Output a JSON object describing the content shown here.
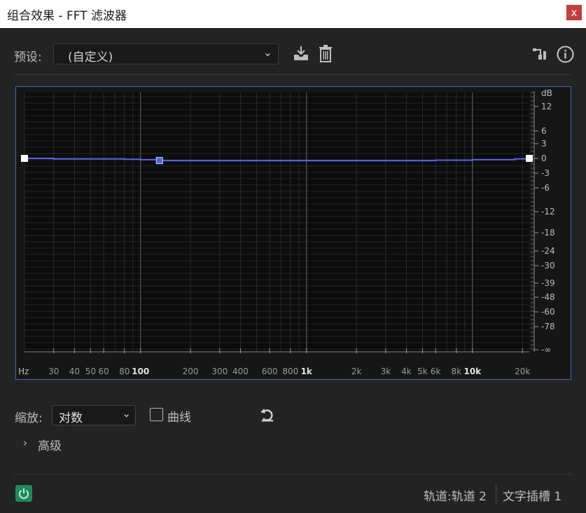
{
  "window": {
    "title": "组合效果 - FFT 滤波器",
    "close_glyph": "x"
  },
  "presets": {
    "label": "预设:",
    "value": "(自定义)"
  },
  "graph": {
    "db_unit": "dB",
    "db_ticks": [
      "12",
      "6",
      "3",
      "0",
      "-3",
      "-6",
      "-12",
      "-18",
      "-24",
      "-30",
      "-39",
      "-48",
      "-60",
      "-78",
      "-∞"
    ],
    "freq_unit": "Hz",
    "freq_ticks": [
      "30",
      "40",
      "50",
      "60",
      "80",
      "100",
      "200",
      "300",
      "400",
      "600",
      "800",
      "1k",
      "2k",
      "3k",
      "4k",
      "5k",
      "6k",
      "8k",
      "10k",
      "20k"
    ],
    "curve_color": "#5a64e6",
    "grid_color": "#3c3c3c"
  },
  "chart_data": {
    "type": "line",
    "title": "",
    "xlabel": "Hz",
    "ylabel": "dB",
    "x_scale": "log",
    "xlim": [
      20,
      22000
    ],
    "series": [
      {
        "x": [
          20,
          30,
          50,
          80,
          100,
          130,
          4000,
          6000,
          10000,
          18000,
          22000
        ],
        "values": [
          0,
          -0.1,
          -0.1,
          -0.2,
          -0.3,
          -0.5,
          -0.5,
          -0.4,
          -0.3,
          -0.1,
          0
        ]
      }
    ],
    "control_points": [
      {
        "x": 20,
        "y": 0
      },
      {
        "x": 130,
        "y": -0.5
      },
      {
        "x": 22000,
        "y": 0
      }
    ]
  },
  "scale": {
    "label": "缩放:",
    "value": "对数"
  },
  "curve_option": {
    "label": "曲线"
  },
  "advanced": {
    "label": "高级"
  },
  "status": {
    "track": "轨道:轨道 2",
    "slot": "文字插槽 1"
  }
}
